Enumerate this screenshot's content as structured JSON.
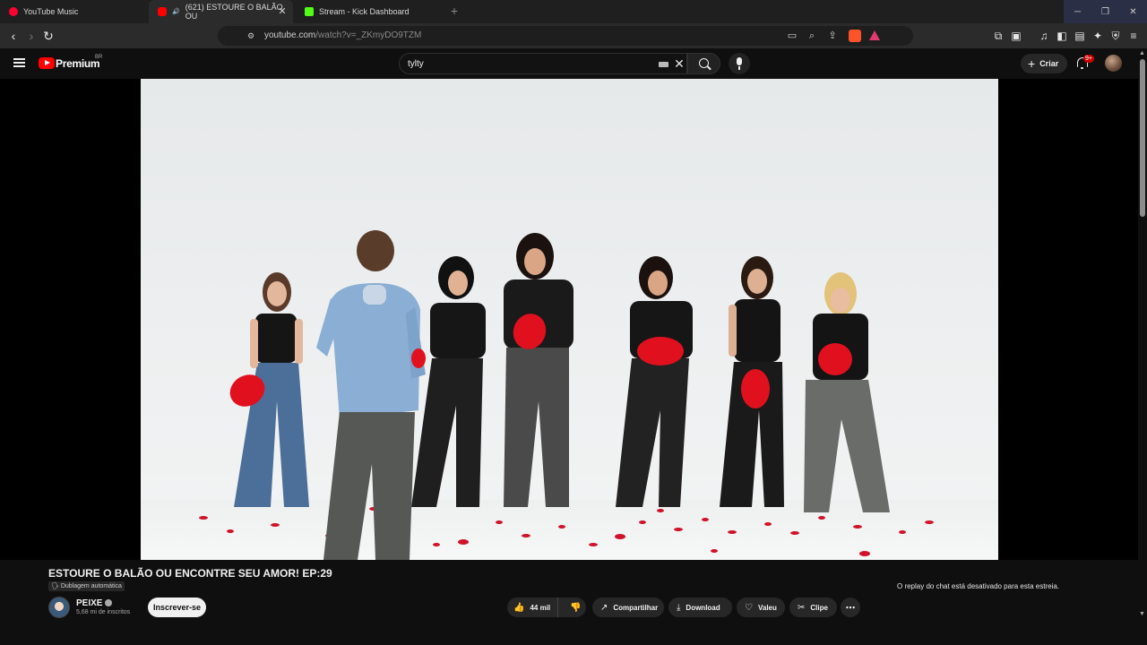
{
  "browser": {
    "tabs": [
      {
        "title": "YouTube Music",
        "favicon_color": "#ff0033"
      },
      {
        "title": "(621) ESTOURE O BALÃO OU",
        "favicon_color": "#ff0000",
        "audio_icon": "🔊"
      },
      {
        "title": "Stream - Kick Dashboard",
        "favicon_color": "#53fc18"
      }
    ],
    "url_host": "youtube.com",
    "url_path": "/watch?v=_ZKmyDO9TZM"
  },
  "youtube": {
    "brand": "Premium",
    "country_code": "BR",
    "search_query": "tylty",
    "create_label": "Criar",
    "notification_badge": "9+"
  },
  "video": {
    "title": "ESTOURE O BALÃO OU ENCONTRE SEU AMOR! EP:29",
    "dub_label": "Dublagem automática",
    "channel": {
      "name": "PEIXE",
      "subscribers": "5,68 mi de inscritos",
      "subscribe_label": "Inscrever-se"
    },
    "actions": {
      "likes": "44 mil",
      "share": "Compartilhar",
      "download": "Download",
      "thanks": "Valeu",
      "clip": "Clipe"
    },
    "chat_notice": "O replay do chat está desativado para esta estreia."
  },
  "colors": {
    "yt_red": "#ff0000",
    "background": "#0f0f0f",
    "balloon_red": "#e0101f"
  }
}
